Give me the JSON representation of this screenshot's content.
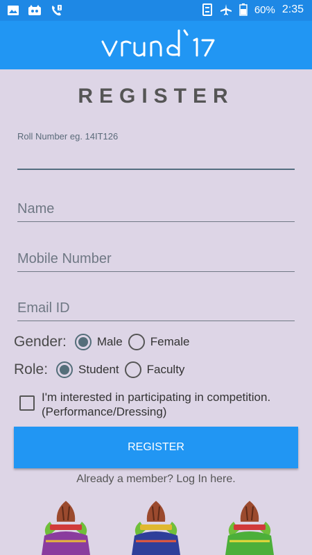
{
  "status_bar": {
    "battery": "60%",
    "time": "2:35",
    "icons": [
      "image-icon",
      "cat-icon",
      "phone-alert-icon",
      "sync-icon",
      "airplane-icon",
      "battery-icon"
    ]
  },
  "app_bar": {
    "logo_text": "vrund'17"
  },
  "form": {
    "title": "REGISTER",
    "roll_label": "Roll Number eg. 14IT126",
    "roll_value": "",
    "name_placeholder": "Name",
    "mobile_placeholder": "Mobile Number",
    "email_placeholder": "Email ID",
    "gender": {
      "label": "Gender:",
      "options": [
        "Male",
        "Female"
      ],
      "selected": "Male"
    },
    "role": {
      "label": "Role:",
      "options": [
        "Student",
        "Faculty"
      ],
      "selected": "Student"
    },
    "competition_checkbox": {
      "label_line1": "I'm interested in participating in competition.",
      "label_line2": "(Performance/Dressing)",
      "checked": false
    },
    "register_button": "REGISTER",
    "login_link": "Already a member? Log In here."
  },
  "colors": {
    "primary": "#2196f3",
    "status_bar": "#1e88e5",
    "background": "#ddd5e6"
  }
}
